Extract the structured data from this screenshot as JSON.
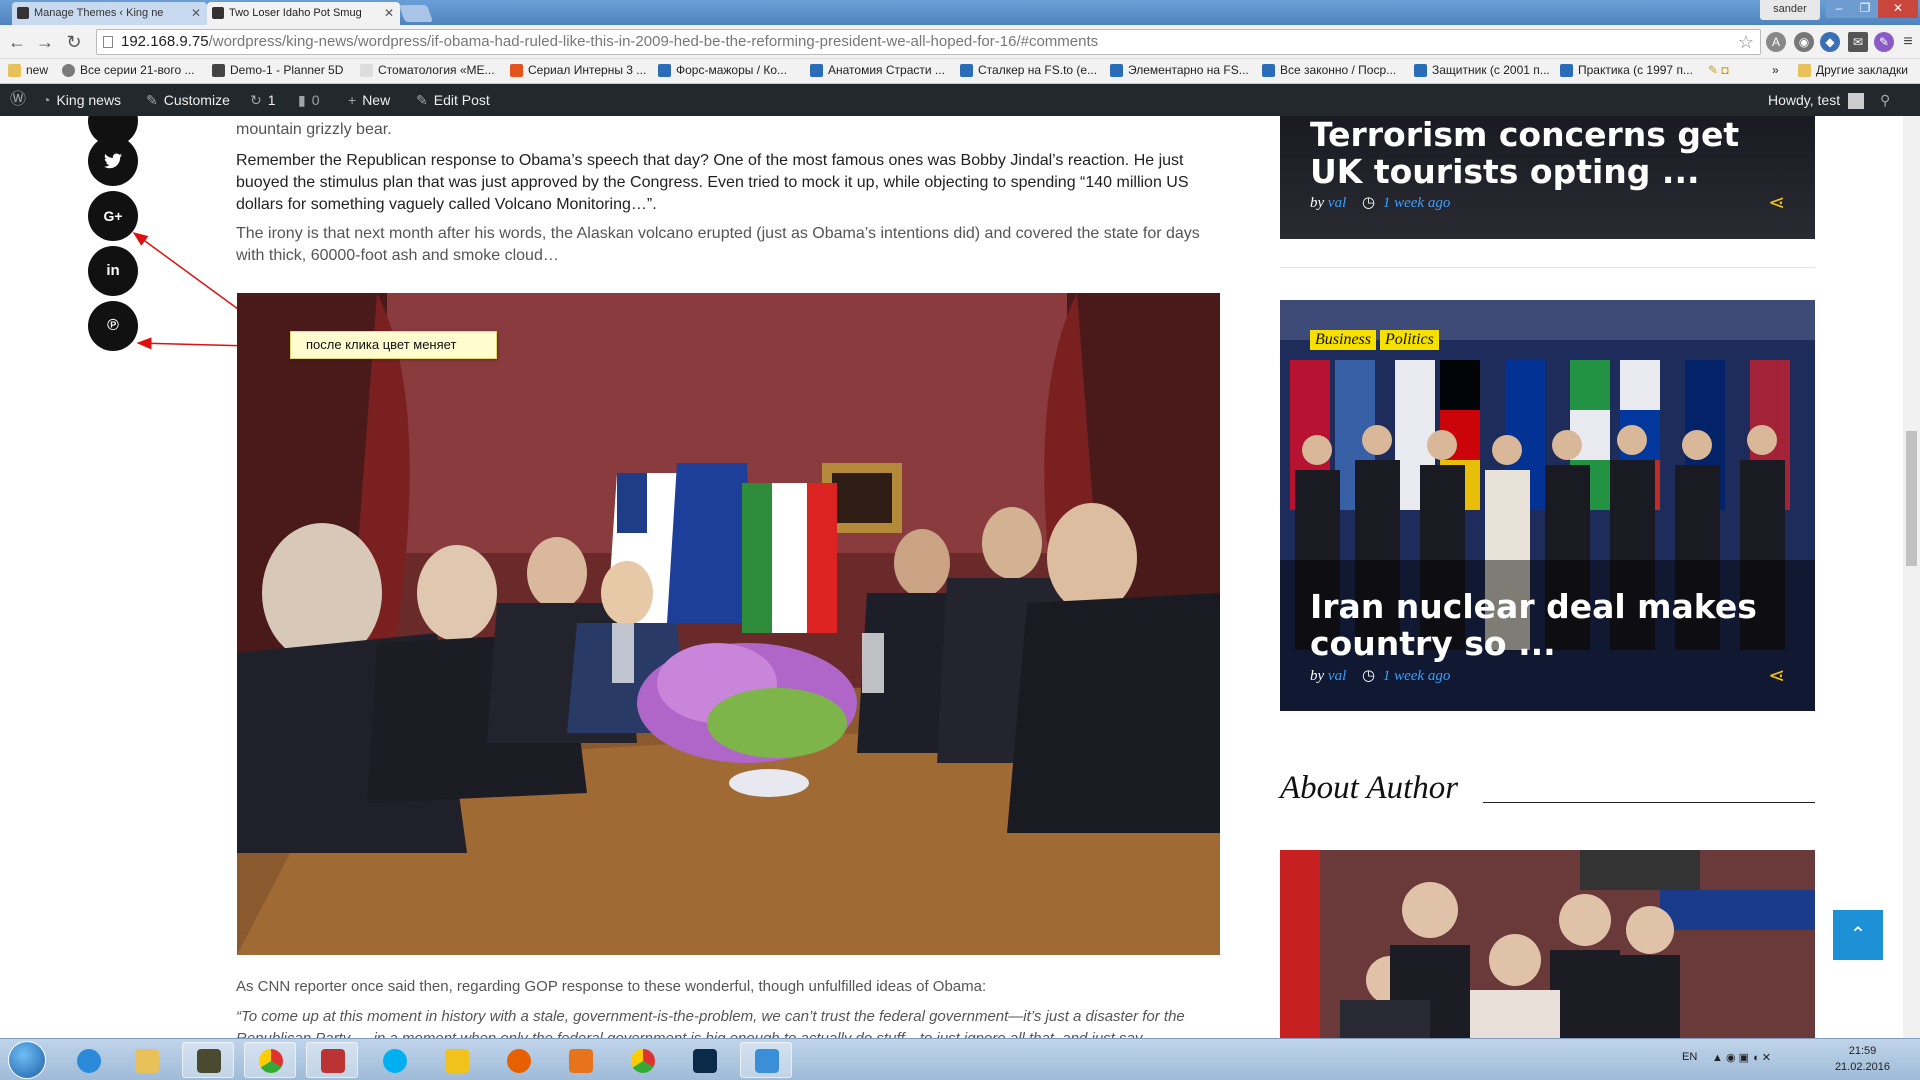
{
  "browser": {
    "tabs": [
      {
        "title": "Manage Themes ‹ King ne",
        "active": false
      },
      {
        "title": "Two Loser Idaho Pot Smug",
        "active": true
      }
    ],
    "user": "sander",
    "url_host": "192.168.9.75",
    "url_path": "/wordpress/king-news/wordpress/if-obama-had-ruled-like-this-in-2009-hed-be-the-reforming-president-we-all-hoped-for-16/#comments",
    "bookmarks": [
      "new",
      "Все серии 21-вого ...",
      "Demo-1 - Planner 5D",
      "Стоматология «МЕ...",
      "Сериал Интерны 3 ...",
      "Форс-мажоры / Ко...",
      "Анатомия Страсти ...",
      "Сталкер на FS.to (е...",
      "Элементарно на FS...",
      "Все законно / Поср...",
      "Защитник (с 2001 п...",
      "Практика (с 1997 п..."
    ],
    "bookmarks_overflow": "»",
    "other_bookmarks": "Другие закладки"
  },
  "wpbar": {
    "site": "King news",
    "customize": "Customize",
    "updates": "1",
    "comments": "0",
    "new": "New",
    "edit": "Edit Post",
    "howdy": "Howdy, test"
  },
  "social": [
    "G+",
    "in",
    "℗"
  ],
  "article": {
    "p0": "mountain grizzly bear.",
    "p1": "Remember the Republican response to Obama’s speech that day? One of the most famous ones was Bobby Jindal’s reaction. He just buoyed the stimulus plan that was just approved by the Congress. Even tried to mock it up, while objecting to spending “140 million US dollars for something vaguely called Volcano Monitoring…”.",
    "p2": "The irony is that next month after his words, the Alaskan volcano erupted (just as Obama’s intentions did) and covered the state for days with thick, 60000-foot ash and smoke cloud…",
    "p3": "As CNN reporter once said then, regarding GOP response to these wonderful, though unfulfilled ideas of Obama:",
    "quote": "“To come up at this moment in history with a stale, government-is-the-problem, we can’t trust the federal government—it’s just a disaster for the Republican Party … in a moment when only the federal government is big enough to actually do stuff—to just ignore all that, and just say"
  },
  "callout": "после клика цвет меняет",
  "sidebar": {
    "card1": {
      "title": "Terrorism concerns get UK tourists opting ...",
      "by": "by",
      "author": "val",
      "time": "1 week ago"
    },
    "card2": {
      "tags": [
        "Business",
        "Politics"
      ],
      "title": "Iran nuclear deal makes country so ...",
      "by": "by",
      "author": "val",
      "time": "1 week ago"
    },
    "about_title": "About Author"
  },
  "taskbar": {
    "lang": "EN",
    "time": "21:59",
    "date": "21.02.2016"
  },
  "colors": {
    "wp_bar": "#23282d",
    "accent_blue": "#1e90d6",
    "tag_yellow": "#f5e000",
    "share_yellow": "#f4c612"
  }
}
